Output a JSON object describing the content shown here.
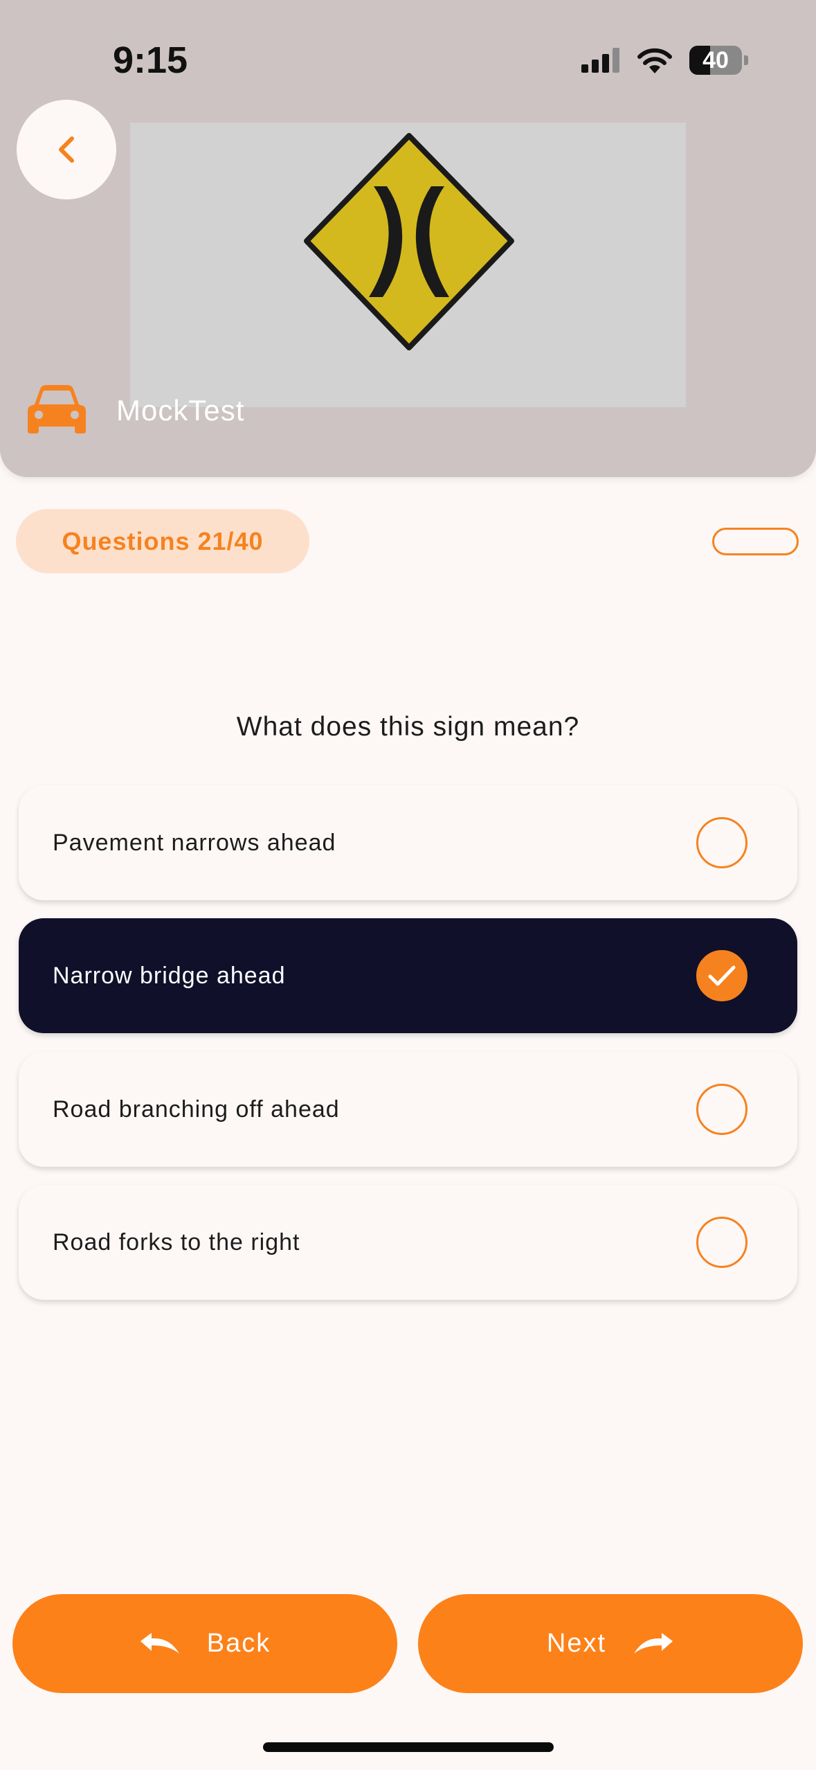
{
  "status_bar": {
    "time": "9:15",
    "battery": "40",
    "icons": [
      "signal-icon",
      "wifi-icon",
      "battery-icon"
    ]
  },
  "header": {
    "back_icon": "chevron-left-icon",
    "brand_icon": "car-icon",
    "brand_name": "MockTest",
    "sign_image": "narrow-bridge-sign"
  },
  "quiz": {
    "counter": "Questions 21/40",
    "question": "What does this sign mean?",
    "options": [
      {
        "label": "Pavement narrows ahead",
        "selected": false
      },
      {
        "label": "Narrow bridge ahead",
        "selected": true
      },
      {
        "label": "Road branching off ahead",
        "selected": false
      },
      {
        "label": "Road forks to the right",
        "selected": false
      }
    ]
  },
  "footer": {
    "back_label": "Back",
    "next_label": "Next",
    "back_icon": "undo-arrow-icon",
    "next_icon": "redo-arrow-icon"
  },
  "colors": {
    "accent": "#fd8119",
    "header_bg": "#cdc3c3",
    "selected_bg": "#10102b",
    "page_bg": "#fdf8f6",
    "counter_bg": "#fde0cc",
    "sign_yellow": "#d4b91e"
  }
}
